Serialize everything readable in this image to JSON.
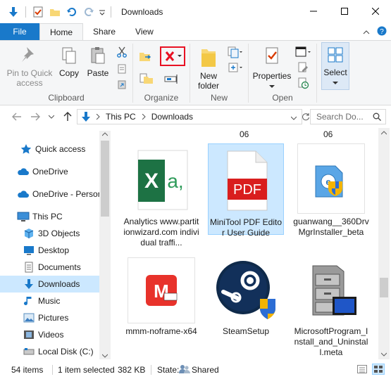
{
  "window": {
    "title": "Downloads"
  },
  "ribbon_tabs": [
    "File",
    "Home",
    "Share",
    "View"
  ],
  "ribbon": {
    "clipboard": {
      "label": "Clipboard",
      "pin": "Pin to Quick access",
      "copy": "Copy",
      "paste": "Paste"
    },
    "organize": {
      "label": "Organize"
    },
    "new": {
      "label": "New",
      "new_folder": "New folder"
    },
    "open": {
      "label": "Open",
      "properties": "Properties"
    },
    "select": {
      "label": "Select"
    }
  },
  "address": {
    "crumbs": [
      "This PC",
      "Downloads"
    ],
    "search_placeholder": "Search Do..."
  },
  "nav": [
    {
      "label": "Quick access",
      "icon": "star-icon"
    },
    {
      "label": "OneDrive",
      "icon": "cloud-icon"
    },
    {
      "label": "OneDrive - Person",
      "icon": "cloud-icon"
    },
    {
      "label": "This PC",
      "icon": "computer-icon"
    },
    {
      "label": "3D Objects",
      "icon": "cube-icon"
    },
    {
      "label": "Desktop",
      "icon": "desktop-icon"
    },
    {
      "label": "Documents",
      "icon": "document-icon"
    },
    {
      "label": "Downloads",
      "icon": "download-icon"
    },
    {
      "label": "Music",
      "icon": "music-icon"
    },
    {
      "label": "Pictures",
      "icon": "pictures-icon"
    },
    {
      "label": "Videos",
      "icon": "video-icon"
    },
    {
      "label": "Local Disk (C:)",
      "icon": "drive-icon"
    }
  ],
  "content": {
    "header_labels": [
      "06",
      "06"
    ],
    "files": [
      {
        "name": "Analytics www.partitionwizard.com individual traffi...",
        "icon": "excel-icon"
      },
      {
        "name": "MiniTool PDF Editor User Guide",
        "icon": "pdf-icon",
        "badge": "PDF"
      },
      {
        "name": "guanwang__360DrvMgrInstaller_beta",
        "icon": "installer-icon"
      },
      {
        "name": "mmm-noframe-x64",
        "icon": "minitool-icon"
      },
      {
        "name": "SteamSetup",
        "icon": "steam-icon"
      },
      {
        "name": "MicrosoftProgram_Install_and_Uninstall.meta",
        "icon": "cabinet-icon"
      }
    ]
  },
  "status": {
    "count": "54 items",
    "selected": "1 item selected",
    "size": "382 KB",
    "state_label": "State:",
    "state_value": "Shared"
  },
  "colors": {
    "accent": "#1979ca",
    "selection": "#cce8ff",
    "delete_red": "#e81123"
  }
}
